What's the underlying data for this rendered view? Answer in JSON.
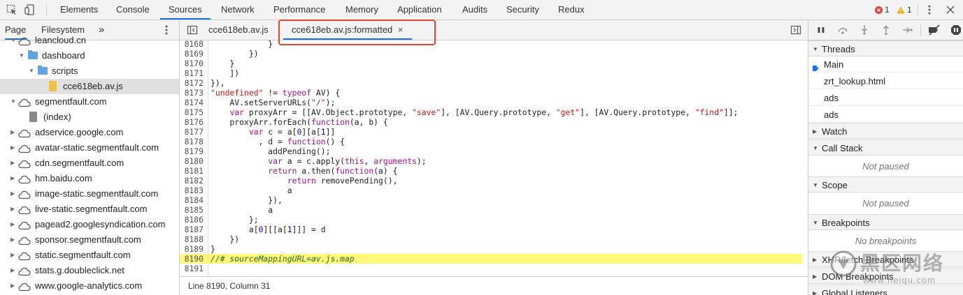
{
  "toolbar": {
    "tabs": [
      {
        "label": "Elements"
      },
      {
        "label": "Console"
      },
      {
        "label": "Sources"
      },
      {
        "label": "Network"
      },
      {
        "label": "Performance"
      },
      {
        "label": "Memory"
      },
      {
        "label": "Application"
      },
      {
        "label": "Audits"
      },
      {
        "label": "Security"
      },
      {
        "label": "Redux"
      }
    ],
    "active_tab": "Sources",
    "error_count": "1",
    "warning_count": "1",
    "error_color": "#e2423b",
    "warning_color": "#f0ab00",
    "accent": "#1a73e8"
  },
  "navigator": {
    "tabs": [
      {
        "label": "Page"
      },
      {
        "label": "Filesystem"
      },
      {
        "label": "»"
      }
    ],
    "tree": [
      {
        "label": "leancloud.cn",
        "kind": "cloud",
        "expanded": true
      },
      {
        "label": "dashboard",
        "kind": "folder",
        "expanded": true
      },
      {
        "label": "scripts",
        "kind": "folder",
        "expanded": true
      },
      {
        "label": "cce618eb.av.js",
        "kind": "file-js",
        "selected": true
      },
      {
        "label": "segmentfault.com",
        "kind": "cloud",
        "expanded": true
      },
      {
        "label": "(index)",
        "kind": "file"
      },
      {
        "label": "adservice.google.com",
        "kind": "cloud"
      },
      {
        "label": "avatar-static.segmentfault.com",
        "kind": "cloud"
      },
      {
        "label": "cdn.segmentfault.com",
        "kind": "cloud"
      },
      {
        "label": "hm.baidu.com",
        "kind": "cloud"
      },
      {
        "label": "image-static.segmentfault.com",
        "kind": "cloud"
      },
      {
        "label": "live-static.segmentfault.com",
        "kind": "cloud"
      },
      {
        "label": "pagead2.googlesyndication.com",
        "kind": "cloud"
      },
      {
        "label": "sponsor.segmentfault.com",
        "kind": "cloud"
      },
      {
        "label": "static.segmentfault.com",
        "kind": "cloud"
      },
      {
        "label": "stats.g.doubleclick.net",
        "kind": "cloud"
      },
      {
        "label": "www.google-analytics.com",
        "kind": "cloud"
      }
    ]
  },
  "editor": {
    "tabs": [
      {
        "label": "cce618eb.av.js"
      },
      {
        "label": "cce618eb.av.js:formatted",
        "close": "×",
        "active": true
      }
    ],
    "lines": [
      {
        "n": "8168",
        "html": "            }"
      },
      {
        "n": "8169",
        "html": "        })"
      },
      {
        "n": "8170",
        "html": "    }"
      },
      {
        "n": "8171",
        "html": "    ])"
      },
      {
        "n": "8172",
        "html": "}),"
      },
      {
        "n": "8173",
        "html": "<span class=\"st\">\"undefined\"</span> != <span class=\"kw\">typeof</span> AV) {"
      },
      {
        "n": "8174",
        "html": "    AV.setServerURLs(<span class=\"st\">\"/\"</span>);"
      },
      {
        "n": "8175",
        "html": "    <span class=\"kw\">var</span> proxyArr = [[AV.Object.prototype, <span class=\"st\">\"save\"</span>], [AV.Query.prototype, <span class=\"st\">\"get\"</span>], [AV.Query.prototype, <span class=\"st\">\"find\"</span>]];"
      },
      {
        "n": "8176",
        "html": "    proxyArr.forEach(<span class=\"kw\">function</span>(a, b) {"
      },
      {
        "n": "8177",
        "html": "        <span class=\"kw\">var</span> c = a[<span class=\"nm\">0</span>][a[<span class=\"nm\">1</span>]]"
      },
      {
        "n": "8178",
        "html": "          , d = <span class=\"kw\">function</span>() {"
      },
      {
        "n": "8179",
        "html": "            addPending();"
      },
      {
        "n": "8180",
        "html": "            <span class=\"kw\">var</span> a = c.apply(<span class=\"kw\">this</span>, <span class=\"kw\">arguments</span>);"
      },
      {
        "n": "8181",
        "html": "            <span class=\"kw\">return</span> a.then(<span class=\"kw\">function</span>(a) {"
      },
      {
        "n": "8182",
        "html": "                <span class=\"kw\">return</span> removePending(),"
      },
      {
        "n": "8183",
        "html": "                a"
      },
      {
        "n": "8184",
        "html": "            }),"
      },
      {
        "n": "8185",
        "html": "            a"
      },
      {
        "n": "8186",
        "html": "        };"
      },
      {
        "n": "8187",
        "html": "        a[<span class=\"nm\">0</span>][[a[<span class=\"nm\">1</span>]]] = d"
      },
      {
        "n": "8188",
        "html": "    })"
      },
      {
        "n": "8189",
        "html": "}"
      },
      {
        "n": "8190",
        "html": "<span class=\"cm\">//# sourceMappingURL=av.js.map</span>",
        "highlight": true
      },
      {
        "n": "8191",
        "html": ""
      }
    ],
    "status": "Line 8190, Column 31"
  },
  "debugger": {
    "threads_title": "Threads",
    "threads": [
      {
        "label": "Main",
        "current": true
      },
      {
        "label": "zrt_lookup.html"
      },
      {
        "label": "ads"
      },
      {
        "label": "ads"
      }
    ],
    "watch_title": "Watch",
    "callstack_title": "Call Stack",
    "not_paused": "Not paused",
    "scope_title": "Scope",
    "scope_not_paused": "Not paused",
    "breakpoints_title": "Breakpoints",
    "no_breakpoints": "No breakpoints",
    "xhr_title": "XHR/fetch Breakpoints",
    "dom_title": "DOM Breakpoints",
    "global_title": "Global Listeners"
  },
  "watermark": {
    "text": "黑区网络",
    "url": "www.heiqu.com"
  }
}
